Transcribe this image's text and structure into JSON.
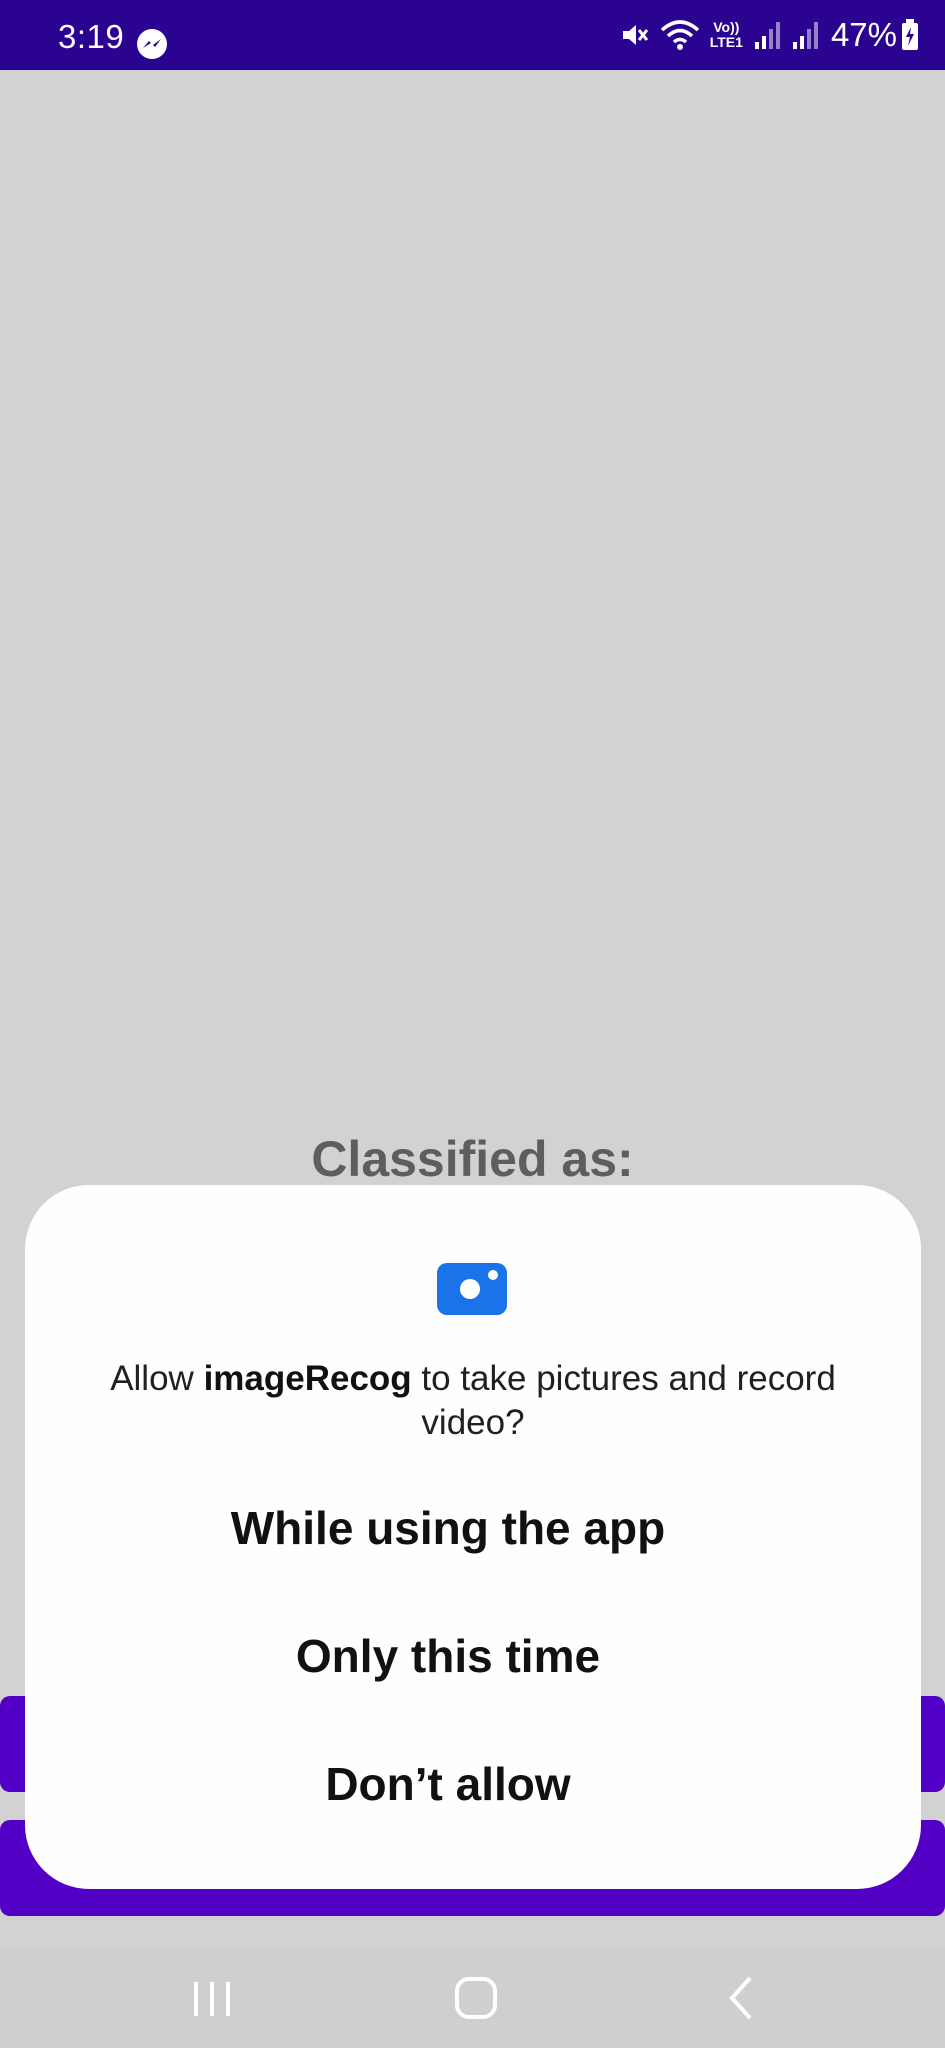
{
  "status_bar": {
    "time": "3:19",
    "battery_percent": "47%",
    "icons": [
      "messenger-icon",
      "mute-icon",
      "wifi-icon",
      "volte-icon",
      "signal-1-icon",
      "signal-2-icon",
      "battery-charging-icon"
    ],
    "volte_text_top": "Vo))",
    "volte_text_bottom": "LTE1",
    "background_color": "#2b0391"
  },
  "app": {
    "classified_label": "Classified as:",
    "button_color": "#5200c6"
  },
  "dialog": {
    "icon": "camera-icon",
    "message_prefix": "Allow ",
    "app_name": "imageRecog",
    "message_suffix": " to take pictures and record video?",
    "options": [
      {
        "label": "While using the app"
      },
      {
        "label": "Only this time"
      },
      {
        "label": "Don’t allow"
      }
    ],
    "accent_color": "#1a73e8"
  },
  "nav_bar": {
    "icons": [
      "recents-icon",
      "home-icon",
      "back-icon"
    ]
  }
}
